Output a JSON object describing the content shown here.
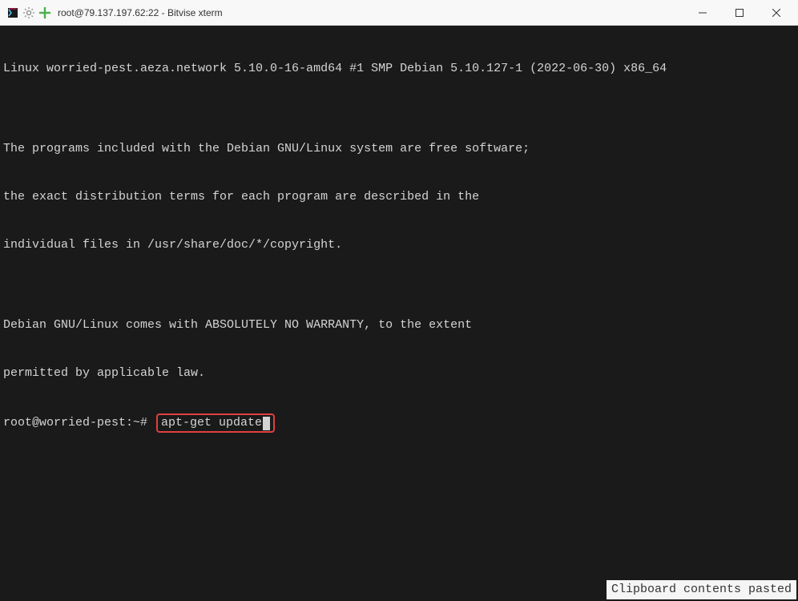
{
  "titlebar": {
    "title": "root@79.137.197.62:22 - Bitvise xterm"
  },
  "terminal": {
    "lines": [
      "Linux worried-pest.aeza.network 5.10.0-16-amd64 #1 SMP Debian 5.10.127-1 (2022-06-30) x86_64",
      "",
      "The programs included with the Debian GNU/Linux system are free software;",
      "the exact distribution terms for each program are described in the",
      "individual files in /usr/share/doc/*/copyright.",
      "",
      "Debian GNU/Linux comes with ABSOLUTELY NO WARRANTY, to the extent",
      "permitted by applicable law."
    ],
    "prompt": "root@worried-pest:~# ",
    "command": "apt-get update"
  },
  "notice": "Clipboard contents pasted"
}
